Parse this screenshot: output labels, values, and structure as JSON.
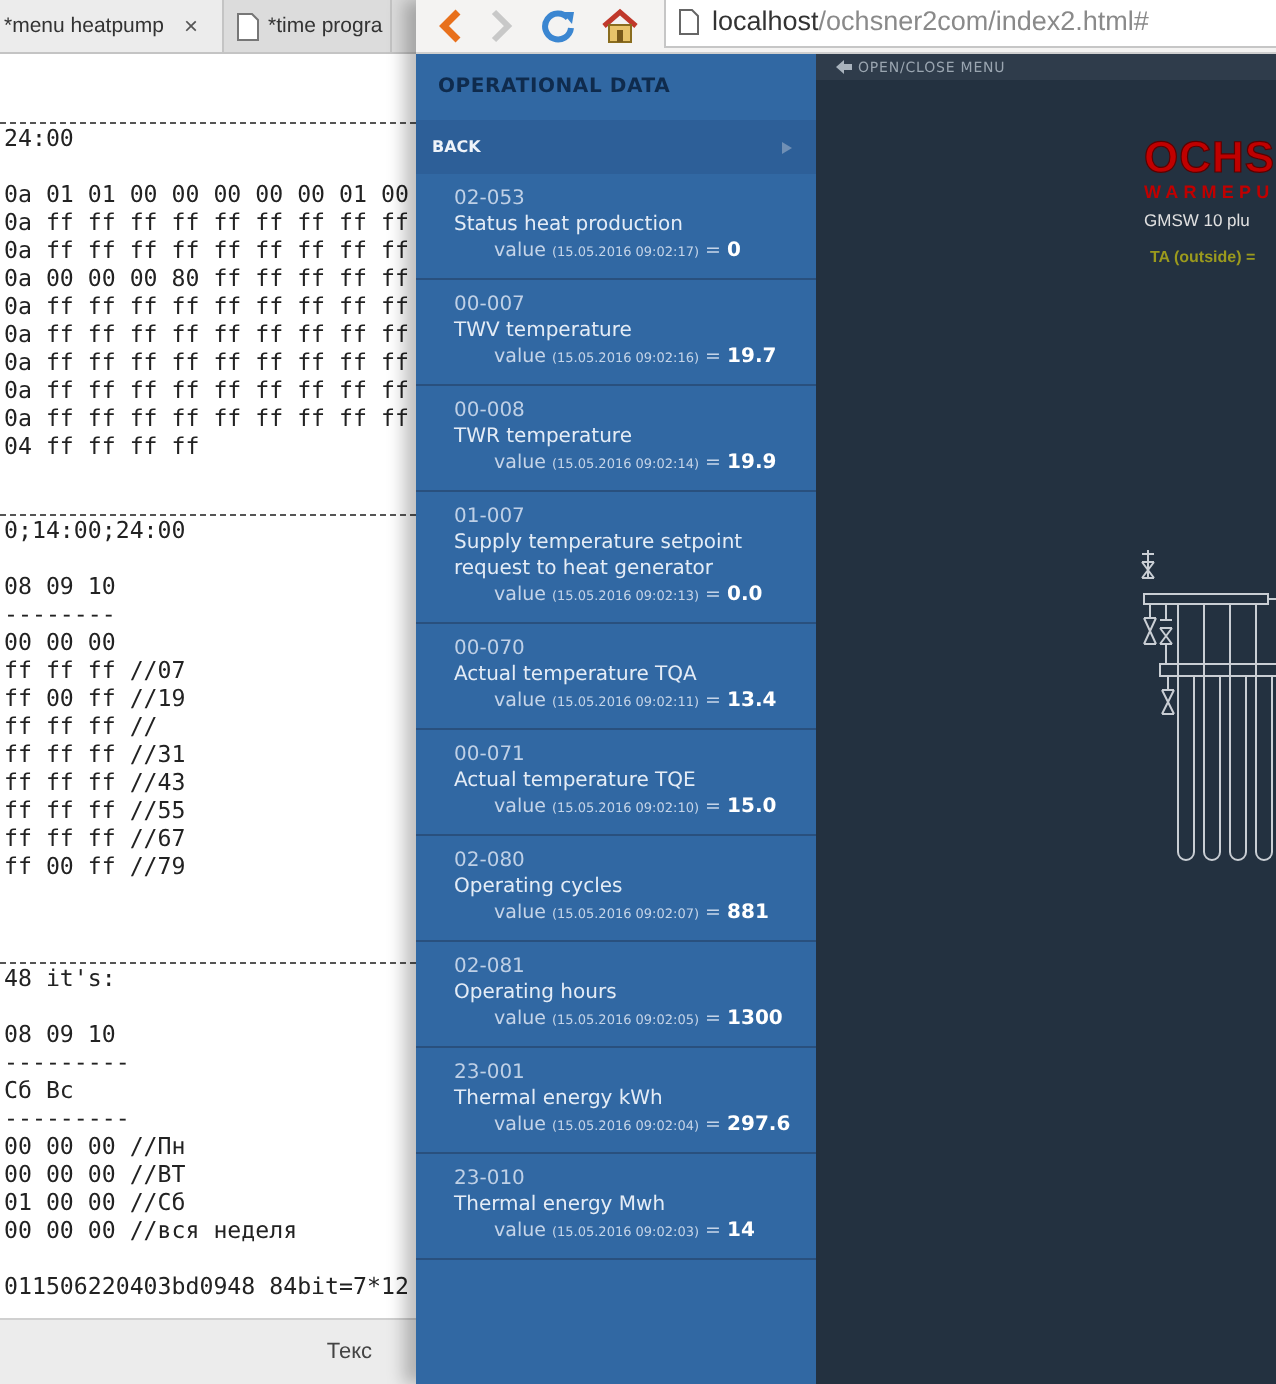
{
  "editor": {
    "tabs": [
      {
        "label": "*menu heatpump",
        "selected": true,
        "close": "×"
      },
      {
        "label": "*time progra",
        "selected": false
      }
    ],
    "lines": [
      {
        "kind": "blank"
      },
      {
        "kind": "rule"
      },
      {
        "kind": "text",
        "text": "24:00"
      },
      {
        "kind": "blank"
      },
      {
        "kind": "text",
        "text": "0a 01 01 00 00 00 00 00 01 00"
      },
      {
        "kind": "text",
        "text": "0a ff ff ff ff ff ff ff ff ff"
      },
      {
        "kind": "text",
        "text": "0a ff ff ff ff ff ff ff ff ff"
      },
      {
        "kind": "text",
        "text": "0a 00 00 00 80 ff ff ff ff ff"
      },
      {
        "kind": "text",
        "text": "0a ff ff ff ff ff ff ff ff ff"
      },
      {
        "kind": "text",
        "text": "0a ff ff ff ff ff ff ff ff ff"
      },
      {
        "kind": "text",
        "text": "0a ff ff ff ff ff ff ff ff ff"
      },
      {
        "kind": "text",
        "text": "0a ff ff ff ff ff ff ff ff ff"
      },
      {
        "kind": "text",
        "text": "0a ff ff ff ff ff ff ff ff ff"
      },
      {
        "kind": "text",
        "text": "04 ff ff ff ff"
      },
      {
        "kind": "blank"
      },
      {
        "kind": "rule"
      },
      {
        "kind": "text",
        "text": "0;14:00;24:00"
      },
      {
        "kind": "blank"
      },
      {
        "kind": "text",
        "text": "08 09 10"
      },
      {
        "kind": "text",
        "text": "--------"
      },
      {
        "kind": "text",
        "text": "00 00 00"
      },
      {
        "kind": "text",
        "text": "ff ff ff //07"
      },
      {
        "kind": "text",
        "text": "ff 00 ff //19"
      },
      {
        "kind": "text",
        "text": "ff ff ff //"
      },
      {
        "kind": "text",
        "text": "ff ff ff //31"
      },
      {
        "kind": "text",
        "text": "ff ff ff //43"
      },
      {
        "kind": "text",
        "text": "ff ff ff //55"
      },
      {
        "kind": "text",
        "text": "ff ff ff //67"
      },
      {
        "kind": "text",
        "text": "ff 00 ff //79"
      },
      {
        "kind": "blank"
      },
      {
        "kind": "blank"
      },
      {
        "kind": "rule"
      },
      {
        "kind": "text",
        "text": "48 it's:"
      },
      {
        "kind": "blank"
      },
      {
        "kind": "text",
        "text": "08 09 10"
      },
      {
        "kind": "text",
        "text": "---------"
      },
      {
        "kind": "text",
        "text": "Сб Вс"
      },
      {
        "kind": "text",
        "text": "---------"
      },
      {
        "kind": "text",
        "text": "00 00 00 //Пн"
      },
      {
        "kind": "text",
        "text": "00 00 00 //ВТ"
      },
      {
        "kind": "text",
        "text": "01 00 00 //Сб"
      },
      {
        "kind": "text",
        "text": "00 00 00 //вся неделя"
      },
      {
        "kind": "blank"
      },
      {
        "kind": "text",
        "text": "011506220403bd0948 84bit=7*12"
      }
    ],
    "status_bar": "Текс"
  },
  "browser": {
    "url_host": "localhost",
    "url_path": "/ochsner2com/index2.html#",
    "sidebar": {
      "title": "OPERATIONAL DATA",
      "back_label": "BACK",
      "items": [
        {
          "code": "02-053",
          "name": "Status heat production",
          "label": "value",
          "timestamp": "(15.05.2016 09:02:17)",
          "sep": "=",
          "value": "0"
        },
        {
          "code": "00-007",
          "name": "TWV temperature",
          "label": "value",
          "timestamp": "(15.05.2016 09:02:16)",
          "sep": "=",
          "value": "19.7"
        },
        {
          "code": "00-008",
          "name": "TWR temperature",
          "label": "value",
          "timestamp": "(15.05.2016 09:02:14)",
          "sep": "=",
          "value": "19.9"
        },
        {
          "code": "01-007",
          "name": "Supply temperature setpoint request to heat generator",
          "label": "value",
          "timestamp": "(15.05.2016 09:02:13)",
          "sep": "=",
          "value": "0.0"
        },
        {
          "code": "00-070",
          "name": "Actual temperature TQA",
          "label": "value",
          "timestamp": "(15.05.2016 09:02:11)",
          "sep": "=",
          "value": "13.4"
        },
        {
          "code": "00-071",
          "name": "Actual temperature TQE",
          "label": "value",
          "timestamp": "(15.05.2016 09:02:10)",
          "sep": "=",
          "value": "15.0"
        },
        {
          "code": "02-080",
          "name": "Operating cycles",
          "label": "value",
          "timestamp": "(15.05.2016 09:02:07)",
          "sep": "=",
          "value": "881"
        },
        {
          "code": "02-081",
          "name": "Operating hours",
          "label": "value",
          "timestamp": "(15.05.2016 09:02:05)",
          "sep": "=",
          "value": "1300"
        },
        {
          "code": "23-001",
          "name": "Thermal energy kWh",
          "label": "value",
          "timestamp": "(15.05.2016 09:02:04)",
          "sep": "=",
          "value": "297.6"
        },
        {
          "code": "23-010",
          "name": "Thermal energy Mwh",
          "label": "value",
          "timestamp": "(15.05.2016 09:02:03)",
          "sep": "=",
          "value": "14"
        }
      ]
    },
    "main": {
      "menu_toggle": "OPEN/CLOSE MENU",
      "logo": "OCHS",
      "logo_subtitle": "WARMEPU",
      "model": "GMSW 10 plu",
      "outside_temp": "TA (outside) ="
    }
  }
}
